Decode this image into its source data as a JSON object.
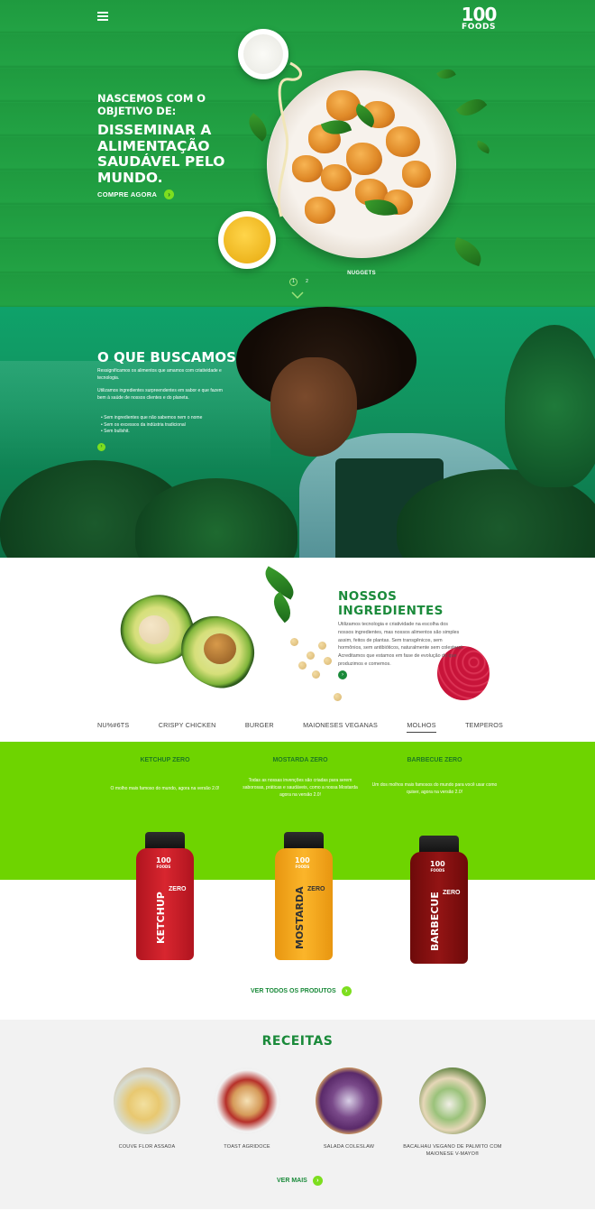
{
  "brand": {
    "number": "100",
    "name": "FOODS"
  },
  "hero": {
    "kicker": "NASCEMOS COM O OBJETIVO DE:",
    "title": "DISSEMINAR A ALIMENTAÇÃO SAUDÁVEL PELO MUNDO.",
    "cta": "COMPRE AGORA",
    "caption": "NUGGETS",
    "pages": [
      "1",
      "2"
    ]
  },
  "buscamos": {
    "title": "O QUE BUSCAMOS",
    "p1": "Ressignificamos os alimentos que amamos com criatividade e tecnologia.",
    "p2": "Utilizamos ingredientes surpreendentes em sabor e que fazem bem à saúde de nossos clientes e do planeta.",
    "list": [
      "Sem ingredientes que não sabemos nem o nome",
      "Sem os excessos da indústria tradicional",
      "Sem bullshit."
    ]
  },
  "ingredientes": {
    "title": "NOSSOS INGREDIENTES",
    "text": "Utilizamos tecnologia e criatividade na escolha dos nossos ingredientes, mas nossos alimentos são simples assim, feitos de plantas. Sem transgênicos, sem hormônios, sem antibióticos, naturalmente sem colesterol. Acreditamos que estamos em fase de evolução do que produzimos e comemos."
  },
  "tabs": [
    {
      "label": "NU%#6TS",
      "active": false
    },
    {
      "label": "CRISPY CHICKEN",
      "active": false
    },
    {
      "label": "BURGER",
      "active": false
    },
    {
      "label": "MAIONESES VEGANAS",
      "active": false
    },
    {
      "label": "MOLHOS",
      "active": true
    },
    {
      "label": "TEMPEROS",
      "active": false
    }
  ],
  "products": [
    {
      "name": "KETCHUP ZERO",
      "desc": "O molho mais famoso do mundo, agora na versão 2.0!",
      "label": "KETCHUP",
      "zero": "ZERO",
      "color": "#d0202e"
    },
    {
      "name": "MOSTARDA ZERO",
      "desc": "Todas as nossas invenções são criadas para serem saborosas, práticas e saudáveis, como a nossa Mostarda agora na versão 2.0!",
      "label": "MOSTARDA",
      "zero": "ZERO",
      "color": "#f5a51b"
    },
    {
      "name": "BARBECUE ZERO",
      "desc": "Um dos molhos mais famosos do mundo para você usar como quiser, agora na versão 2.0!",
      "label": "BARBECUE",
      "zero": "ZERO",
      "color": "#8e1111"
    }
  ],
  "ver_todos": "VER TODOS OS PRODUTOS",
  "receitas": {
    "title": "RECEITAS",
    "items": [
      {
        "caption": "COUVE FLOR ASSADA"
      },
      {
        "caption": "TOAST AGRIDOCE"
      },
      {
        "caption": "SALADA COLESLAW"
      },
      {
        "caption": "BACALHAU VEGANO DE PALMITO COM MAIONESE V-MAYO®"
      }
    ],
    "ver_mais": "VER MAIS"
  }
}
